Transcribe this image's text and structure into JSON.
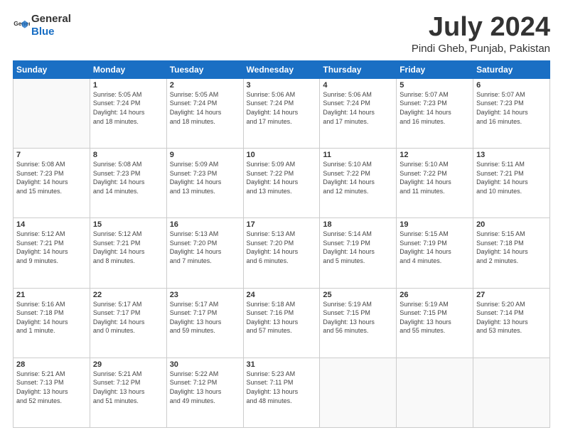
{
  "logo": {
    "general": "General",
    "blue": "Blue"
  },
  "title": "July 2024",
  "subtitle": "Pindi Gheb, Punjab, Pakistan",
  "days_of_week": [
    "Sunday",
    "Monday",
    "Tuesday",
    "Wednesday",
    "Thursday",
    "Friday",
    "Saturday"
  ],
  "weeks": [
    [
      {
        "day": "",
        "info": ""
      },
      {
        "day": "1",
        "info": "Sunrise: 5:05 AM\nSunset: 7:24 PM\nDaylight: 14 hours\nand 18 minutes."
      },
      {
        "day": "2",
        "info": "Sunrise: 5:05 AM\nSunset: 7:24 PM\nDaylight: 14 hours\nand 18 minutes."
      },
      {
        "day": "3",
        "info": "Sunrise: 5:06 AM\nSunset: 7:24 PM\nDaylight: 14 hours\nand 17 minutes."
      },
      {
        "day": "4",
        "info": "Sunrise: 5:06 AM\nSunset: 7:24 PM\nDaylight: 14 hours\nand 17 minutes."
      },
      {
        "day": "5",
        "info": "Sunrise: 5:07 AM\nSunset: 7:23 PM\nDaylight: 14 hours\nand 16 minutes."
      },
      {
        "day": "6",
        "info": "Sunrise: 5:07 AM\nSunset: 7:23 PM\nDaylight: 14 hours\nand 16 minutes."
      }
    ],
    [
      {
        "day": "7",
        "info": "Sunrise: 5:08 AM\nSunset: 7:23 PM\nDaylight: 14 hours\nand 15 minutes."
      },
      {
        "day": "8",
        "info": "Sunrise: 5:08 AM\nSunset: 7:23 PM\nDaylight: 14 hours\nand 14 minutes."
      },
      {
        "day": "9",
        "info": "Sunrise: 5:09 AM\nSunset: 7:23 PM\nDaylight: 14 hours\nand 13 minutes."
      },
      {
        "day": "10",
        "info": "Sunrise: 5:09 AM\nSunset: 7:22 PM\nDaylight: 14 hours\nand 13 minutes."
      },
      {
        "day": "11",
        "info": "Sunrise: 5:10 AM\nSunset: 7:22 PM\nDaylight: 14 hours\nand 12 minutes."
      },
      {
        "day": "12",
        "info": "Sunrise: 5:10 AM\nSunset: 7:22 PM\nDaylight: 14 hours\nand 11 minutes."
      },
      {
        "day": "13",
        "info": "Sunrise: 5:11 AM\nSunset: 7:21 PM\nDaylight: 14 hours\nand 10 minutes."
      }
    ],
    [
      {
        "day": "14",
        "info": "Sunrise: 5:12 AM\nSunset: 7:21 PM\nDaylight: 14 hours\nand 9 minutes."
      },
      {
        "day": "15",
        "info": "Sunrise: 5:12 AM\nSunset: 7:21 PM\nDaylight: 14 hours\nand 8 minutes."
      },
      {
        "day": "16",
        "info": "Sunrise: 5:13 AM\nSunset: 7:20 PM\nDaylight: 14 hours\nand 7 minutes."
      },
      {
        "day": "17",
        "info": "Sunrise: 5:13 AM\nSunset: 7:20 PM\nDaylight: 14 hours\nand 6 minutes."
      },
      {
        "day": "18",
        "info": "Sunrise: 5:14 AM\nSunset: 7:19 PM\nDaylight: 14 hours\nand 5 minutes."
      },
      {
        "day": "19",
        "info": "Sunrise: 5:15 AM\nSunset: 7:19 PM\nDaylight: 14 hours\nand 4 minutes."
      },
      {
        "day": "20",
        "info": "Sunrise: 5:15 AM\nSunset: 7:18 PM\nDaylight: 14 hours\nand 2 minutes."
      }
    ],
    [
      {
        "day": "21",
        "info": "Sunrise: 5:16 AM\nSunset: 7:18 PM\nDaylight: 14 hours\nand 1 minute."
      },
      {
        "day": "22",
        "info": "Sunrise: 5:17 AM\nSunset: 7:17 PM\nDaylight: 14 hours\nand 0 minutes."
      },
      {
        "day": "23",
        "info": "Sunrise: 5:17 AM\nSunset: 7:17 PM\nDaylight: 13 hours\nand 59 minutes."
      },
      {
        "day": "24",
        "info": "Sunrise: 5:18 AM\nSunset: 7:16 PM\nDaylight: 13 hours\nand 57 minutes."
      },
      {
        "day": "25",
        "info": "Sunrise: 5:19 AM\nSunset: 7:15 PM\nDaylight: 13 hours\nand 56 minutes."
      },
      {
        "day": "26",
        "info": "Sunrise: 5:19 AM\nSunset: 7:15 PM\nDaylight: 13 hours\nand 55 minutes."
      },
      {
        "day": "27",
        "info": "Sunrise: 5:20 AM\nSunset: 7:14 PM\nDaylight: 13 hours\nand 53 minutes."
      }
    ],
    [
      {
        "day": "28",
        "info": "Sunrise: 5:21 AM\nSunset: 7:13 PM\nDaylight: 13 hours\nand 52 minutes."
      },
      {
        "day": "29",
        "info": "Sunrise: 5:21 AM\nSunset: 7:12 PM\nDaylight: 13 hours\nand 51 minutes."
      },
      {
        "day": "30",
        "info": "Sunrise: 5:22 AM\nSunset: 7:12 PM\nDaylight: 13 hours\nand 49 minutes."
      },
      {
        "day": "31",
        "info": "Sunrise: 5:23 AM\nSunset: 7:11 PM\nDaylight: 13 hours\nand 48 minutes."
      },
      {
        "day": "",
        "info": ""
      },
      {
        "day": "",
        "info": ""
      },
      {
        "day": "",
        "info": ""
      }
    ]
  ]
}
